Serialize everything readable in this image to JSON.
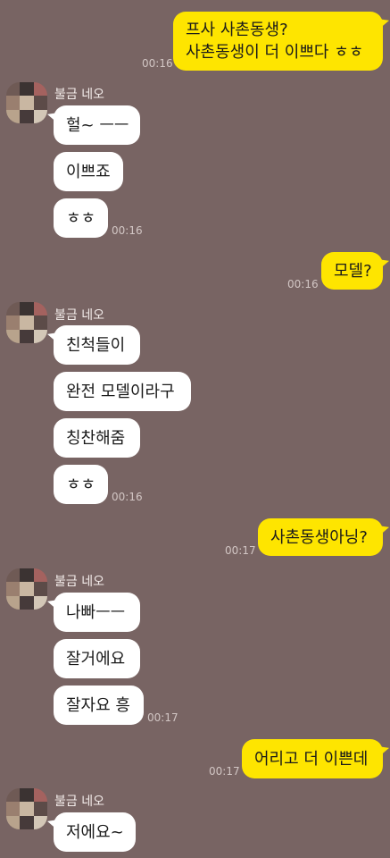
{
  "colors": {
    "background": "#786463",
    "incoming_bubble": "#ffffff",
    "outgoing_bubble": "#fee500",
    "timestamp": "#d2c6c4"
  },
  "contact": {
    "name": "불금 네오",
    "avatar_icon": "pixelated-avatar-icon"
  },
  "messages": [
    {
      "sender": "me",
      "lines": [
        "프사 사촌동생?",
        "사촌동생이 더 이쁘다 ㅎㅎ"
      ],
      "time": "00:16"
    },
    {
      "sender": "contact",
      "text": "헐~ ㅡㅡ"
    },
    {
      "sender": "contact",
      "text": "이쁘죠"
    },
    {
      "sender": "contact",
      "text": "ㅎㅎ",
      "time": "00:16"
    },
    {
      "sender": "me",
      "text": "모델?",
      "time": "00:16"
    },
    {
      "sender": "contact",
      "text": "친척들이"
    },
    {
      "sender": "contact",
      "text": "완전 모델이라구"
    },
    {
      "sender": "contact",
      "text": "칭찬해줌"
    },
    {
      "sender": "contact",
      "text": "ㅎㅎ",
      "time": "00:16"
    },
    {
      "sender": "me",
      "text": "사촌동생아닝?",
      "time": "00:17"
    },
    {
      "sender": "contact",
      "text": "나빠ㅡㅡ"
    },
    {
      "sender": "contact",
      "text": "잘거에요"
    },
    {
      "sender": "contact",
      "text": "잘자요 흥",
      "time": "00:17"
    },
    {
      "sender": "me",
      "text": "어리고 더 이쁜데",
      "time": "00:17"
    },
    {
      "sender": "contact",
      "text": "저에요~"
    }
  ]
}
